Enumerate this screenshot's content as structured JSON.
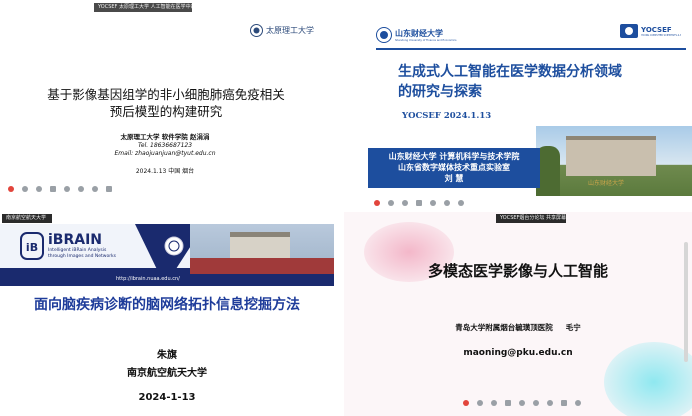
{
  "p1": {
    "meeting_label": "YOCSEF 太原理工大学 人工智能在医学中的应用",
    "logo_text": "太原理工大学",
    "title_line1": "基于影像基因组学的非小细胞肺癌免疫相关",
    "title_line2": "预后模型的构建研究",
    "affiliation": "太原理工大学 软件学院 赵涓涓",
    "tel": "Tel. 18636687123",
    "email": "Email: zhaojuanjuan@tyut.edu.cn",
    "date_place": "2024.1.13 中国 烟台"
  },
  "p2": {
    "uni_logo_text": "山东财经大学",
    "uni_logo_sub": "Shandong University of Finance and Economics",
    "yocsef_logo": "YOCSEF",
    "yocsef_logo_sub": "YOUNG COMPUTER SCIENTISTS & ENGINEERS FORUM",
    "title_line1": "生成式人工智能在医学数据分析领域",
    "title_line2": "的研究与探索",
    "event": "YOCSEF  2024.1.13",
    "dept1": "山东财经大学  计算机科学与技术学院",
    "dept2": "山东省数字媒体技术重点实验室",
    "name": "刘  慧",
    "building_text": "山东财经大学"
  },
  "p3": {
    "meeting_label": "南京航空航天大学",
    "brand": "iBRAIN",
    "brand_sub1": "Intelligent iBRain Analysis",
    "brand_sub2": "through Images and Networks",
    "url": "http://ibrain.nuaa.edu.cn/",
    "title": "面向脑疾病诊断的脑网络拓扑信息挖掘方法",
    "name": "朱旗",
    "affiliation": "南京航空航天大学",
    "date": "2024-1-13"
  },
  "p4": {
    "meeting_label": "YOCSEF烟台分论坛 共享屏幕",
    "title": "多模态医学影像与人工智能",
    "affiliation": "青岛大学附属烟台毓璜顶医院     毛宁",
    "email": "maoning@pku.edu.cn"
  },
  "colors": {
    "p2_blue": "#1d4e9e",
    "p3_navy": "#1a2a6e",
    "p3_blue_text": "#1e3c9a",
    "p4_pink": "#f3b7c9",
    "p4_cyan": "#8fe8f0"
  }
}
